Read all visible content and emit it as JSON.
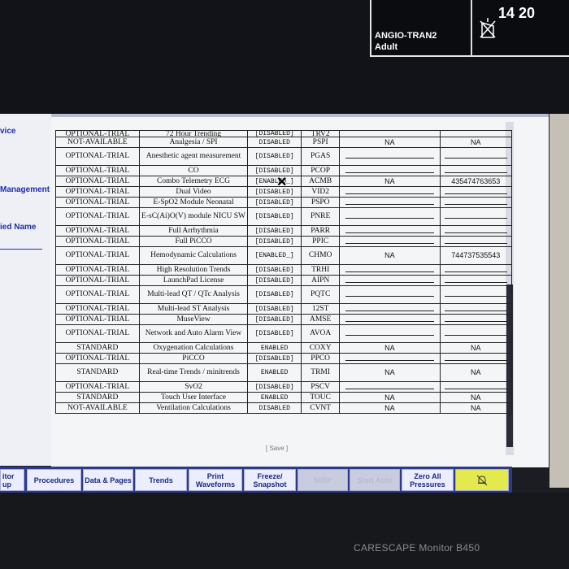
{
  "header": {
    "bed_line1": "ANGIO-TRAN2",
    "bed_line2": "Adult",
    "clock": "14 20"
  },
  "left_panel": {
    "labels": [
      "vice",
      "Management",
      "ied Name"
    ]
  },
  "table": {
    "partial_top": {
      "status": "OPTIONAL-TRIAL",
      "option": "72 Hour Trending",
      "state": "[DISABLED]",
      "code": "TRV2"
    },
    "rows": [
      {
        "status": "NOT-AVAILABLE",
        "option": "Analgesia / SPI",
        "state": "DISABLED",
        "code": "PSPI",
        "c5": "NA",
        "c6": "NA"
      },
      {
        "status": "OPTIONAL-TRIAL",
        "option": "Anesthetic agent measurement",
        "state": "[DISABLED]",
        "code": "PGAS",
        "c5": "",
        "c6": ""
      },
      {
        "status": "OPTIONAL-TRIAL",
        "option": "CO",
        "state": "[DISABLED]",
        "code": "PCOP",
        "c5": "",
        "c6": ""
      },
      {
        "status": "OPTIONAL-TRIAL",
        "option": "Combo Telemetry ECG",
        "state": "[ENABLED_]",
        "code": "ACMB",
        "c5": "NA",
        "c6": "435474763653"
      },
      {
        "status": "OPTIONAL-TRIAL",
        "option": "Dual Video",
        "state": "[DISABLED]",
        "code": "VID2",
        "c5": "",
        "c6": ""
      },
      {
        "status": "OPTIONAL-TRIAL",
        "option": "E-SpO2 Module Neonatal",
        "state": "[DISABLED]",
        "code": "PSPO",
        "c5": "",
        "c6": ""
      },
      {
        "status": "OPTIONAL-TRIAL",
        "option": "E-sC(Ai)O(V) module NICU SW",
        "state": "[DISABLED]",
        "code": "PNRE",
        "c5": "",
        "c6": ""
      },
      {
        "status": "OPTIONAL-TRIAL",
        "option": "Full Arrhythmia",
        "state": "[DISABLED]",
        "code": "PARR",
        "c5": "",
        "c6": ""
      },
      {
        "status": "OPTIONAL-TRIAL",
        "option": "Full PiCCO",
        "state": "[DISABLED]",
        "code": "PPIC",
        "c5": "",
        "c6": ""
      },
      {
        "status": "OPTIONAL-TRIAL",
        "option": "Hemodynamic Calculations",
        "state": "[ENABLED_]",
        "code": "CHMO",
        "c5": "NA",
        "c6": "744737535543"
      },
      {
        "status": "OPTIONAL-TRIAL",
        "option": "High Resolution Trends",
        "state": "[DISABLED]",
        "code": "TRHI",
        "c5": "",
        "c6": ""
      },
      {
        "status": "OPTIONAL-TRIAL",
        "option": "LaunchPad License",
        "state": "[DISABLED]",
        "code": "AIPN",
        "c5": "",
        "c6": ""
      },
      {
        "status": "OPTIONAL-TRIAL",
        "option": "Multi-lead QT / QTc Analysis",
        "state": "[DISABLED]",
        "code": "PQTC",
        "c5": "",
        "c6": ""
      },
      {
        "status": "OPTIONAL-TRIAL",
        "option": "Multi-lead ST Analysis",
        "state": "[DISABLED]",
        "code": "12ST",
        "c5": "",
        "c6": ""
      },
      {
        "status": "OPTIONAL-TRIAL",
        "option": "MuseView",
        "state": "[DISABLED]",
        "code": "AMSE",
        "c5": "",
        "c6": ""
      },
      {
        "status": "OPTIONAL-TRIAL",
        "option": "Network and Auto Alarm View",
        "state": "[DISABLED]",
        "code": "AVOA",
        "c5": "",
        "c6": ""
      },
      {
        "status": "STANDARD",
        "option": "Oxygenation Calculations",
        "state": "ENABLED",
        "code": "COXY",
        "c5": "NA",
        "c6": "NA"
      },
      {
        "status": "OPTIONAL-TRIAL",
        "option": "PiCCO",
        "state": "[DISABLED]",
        "code": "PPCO",
        "c5": "",
        "c6": ""
      },
      {
        "status": "STANDARD",
        "option": "Real-time Trends / minitrends",
        "state": "ENABLED",
        "code": "TRMI",
        "c5": "NA",
        "c6": "NA"
      },
      {
        "status": "OPTIONAL-TRIAL",
        "option": "SvO2",
        "state": "[DISABLED]",
        "code": "PSCV",
        "c5": "",
        "c6": ""
      },
      {
        "status": "STANDARD",
        "option": "Touch User Interface",
        "state": "ENABLED",
        "code": "TOUC",
        "c5": "NA",
        "c6": "NA"
      },
      {
        "status": "NOT-AVAILABLE",
        "option": "Ventilation Calculations",
        "state": "DISABLED",
        "code": "CVNT",
        "c5": "NA",
        "c6": "NA"
      }
    ],
    "save_label": "[ Save ]"
  },
  "toolbar": {
    "left_cut_1": "itor",
    "left_cut_2": "up",
    "procedures": "Procedures",
    "data_pages": "Data & Pages",
    "trends": "Trends",
    "print_waveforms": "Print Waveforms",
    "freeze_snapshot": "Freeze/ Snapshot",
    "nibp": "NIBP",
    "start_auto": "Start Auto",
    "zero_all": "Zero All Pressures"
  },
  "bezel": {
    "brand": "CARESCAPE Monitor B450"
  },
  "colors": {
    "toolbar_bg": "#2e3a87",
    "button_bg": "#eceeff",
    "alarm_button": "#e4ea4d",
    "label_blue": "#1d2fa8"
  },
  "tall_rows": [
    1,
    6,
    9,
    12,
    15,
    18
  ]
}
